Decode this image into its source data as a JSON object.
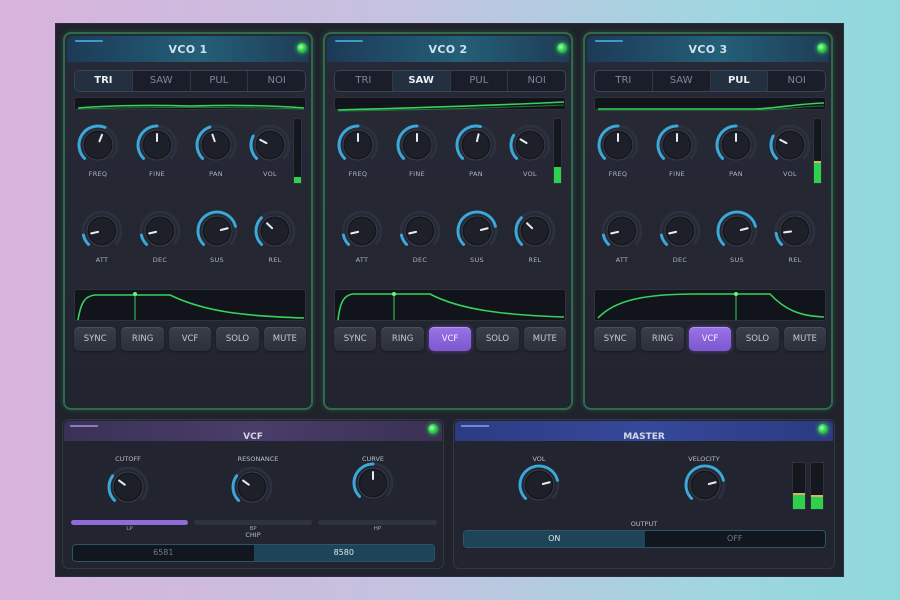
{
  "vcos": [
    {
      "title": "VCO 1",
      "waveforms": [
        "TRI",
        "SAW",
        "PUL",
        "NOI"
      ],
      "selected_waveform": "TRI",
      "knobs_row1": [
        {
          "label": "FREQ",
          "value": 0.58
        },
        {
          "label": "FINE",
          "value": 0.5
        },
        {
          "label": "PAN",
          "value": 0.43
        },
        {
          "label": "VOL",
          "value": 0.27
        }
      ],
      "knobs_row2": [
        {
          "label": "ATT",
          "value": 0.12
        },
        {
          "label": "DEC",
          "value": 0.12
        },
        {
          "label": "SUS",
          "value": 0.78
        },
        {
          "label": "REL",
          "value": 0.33
        }
      ],
      "level_meter": 0.1,
      "buttons": [
        "SYNC",
        "RING",
        "VCF",
        "SOLO",
        "MUTE"
      ],
      "active_buttons": []
    },
    {
      "title": "VCO 2",
      "waveforms": [
        "TRI",
        "SAW",
        "PUL",
        "NOI"
      ],
      "selected_waveform": "SAW",
      "knobs_row1": [
        {
          "label": "FREQ",
          "value": 0.5
        },
        {
          "label": "FINE",
          "value": 0.5
        },
        {
          "label": "PAN",
          "value": 0.55
        },
        {
          "label": "VOL",
          "value": 0.28
        }
      ],
      "knobs_row2": [
        {
          "label": "ATT",
          "value": 0.12
        },
        {
          "label": "DEC",
          "value": 0.12
        },
        {
          "label": "SUS",
          "value": 0.78
        },
        {
          "label": "REL",
          "value": 0.33
        }
      ],
      "level_meter": 0.25,
      "buttons": [
        "SYNC",
        "RING",
        "VCF",
        "SOLO",
        "MUTE"
      ],
      "active_buttons": [
        "VCF"
      ]
    },
    {
      "title": "VCO 3",
      "waveforms": [
        "TRI",
        "SAW",
        "PUL",
        "NOI"
      ],
      "selected_waveform": "PUL",
      "knobs_row1": [
        {
          "label": "FREQ",
          "value": 0.5
        },
        {
          "label": "FINE",
          "value": 0.5
        },
        {
          "label": "PAN",
          "value": 0.5
        },
        {
          "label": "VOL",
          "value": 0.27
        }
      ],
      "knobs_row2": [
        {
          "label": "ATT",
          "value": 0.12
        },
        {
          "label": "DEC",
          "value": 0.12
        },
        {
          "label": "SUS",
          "value": 0.78
        },
        {
          "label": "REL",
          "value": 0.14
        }
      ],
      "level_meter": 0.32,
      "buttons": [
        "SYNC",
        "RING",
        "VCF",
        "SOLO",
        "MUTE"
      ],
      "active_buttons": [
        "VCF"
      ]
    }
  ],
  "vcf": {
    "title": "VCF",
    "knobs": [
      {
        "label": "CUTOFF",
        "value": 0.3
      },
      {
        "label": "RESONANCE",
        "value": 0.3
      },
      {
        "label": "CURVE",
        "value": 0.5
      }
    ],
    "filter_modes": [
      "LP",
      "BP",
      "HP"
    ],
    "active_filter": "LP",
    "chip_label": "CHIP",
    "chips": [
      "6581",
      "8580"
    ],
    "selected_chip": "8580"
  },
  "master": {
    "title": "MASTER",
    "knobs": [
      {
        "label": "VOL",
        "value": 0.78
      },
      {
        "label": "VELOCITY",
        "value": 0.78
      }
    ],
    "output_label": "OUTPUT",
    "output_options": [
      "ON",
      "OFF"
    ],
    "selected_output": "ON",
    "meters": [
      0.3,
      0.27
    ]
  },
  "colors": {
    "accent_cyan": "#3aa8d8",
    "led_green": "#2fd04e",
    "active_purple": "#8e6bd8",
    "panel_bg": "#22242f"
  }
}
